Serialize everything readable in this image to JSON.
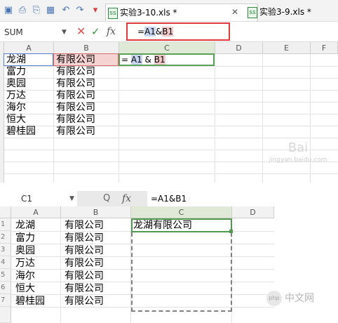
{
  "top": {
    "tabs": [
      {
        "label": "实验3-10.xls *",
        "active": true
      },
      {
        "label": "实验3-9.xls *",
        "active": false
      }
    ],
    "tab_icon": "ss",
    "name_box": "SUM",
    "fx_label": "fx",
    "formula": {
      "prefix": "=",
      "ref1": "A1",
      "op": "&",
      "ref2": "B1"
    },
    "edit_cell": {
      "prefix": "= ",
      "ref1": "A1",
      "op": " & ",
      "ref2": "B1"
    },
    "columns": [
      "A",
      "B",
      "C",
      "D",
      "E",
      "F"
    ],
    "col_a": [
      "龙湖",
      "富力",
      "奥园",
      "万达",
      "海尔",
      "恒大",
      "碧桂园"
    ],
    "col_b": [
      "有限公司",
      "有限公司",
      "有限公司",
      "有限公司",
      "有限公司",
      "有限公司",
      "有限公司"
    ]
  },
  "bottom": {
    "name_box": "C1",
    "zoom_icon": "Q",
    "fx_label": "fx",
    "formula": "=A1&B1",
    "columns": [
      "A",
      "B",
      "C",
      "D"
    ],
    "row_numbers": [
      "1",
      "2",
      "3",
      "4",
      "5",
      "6",
      "7"
    ],
    "col_a": [
      "龙湖",
      "富力",
      "奥园",
      "万达",
      "海尔",
      "恒大",
      "碧桂园"
    ],
    "col_b": [
      "有限公司",
      "有限公司",
      "有限公司",
      "有限公司",
      "有限公司",
      "有限公司",
      "有限公司"
    ],
    "c1_result": "龙湖有限公司"
  },
  "watermark": {
    "top_line": "Bai",
    "top_small": "jingyan.baidu.com",
    "badge": "php",
    "text": "中文网"
  },
  "colors": {
    "accent_red": "#e03a3a",
    "ref_blue": "#c8d6f2",
    "ref_red": "#f2c8c8",
    "active_green": "#5aa25a"
  }
}
